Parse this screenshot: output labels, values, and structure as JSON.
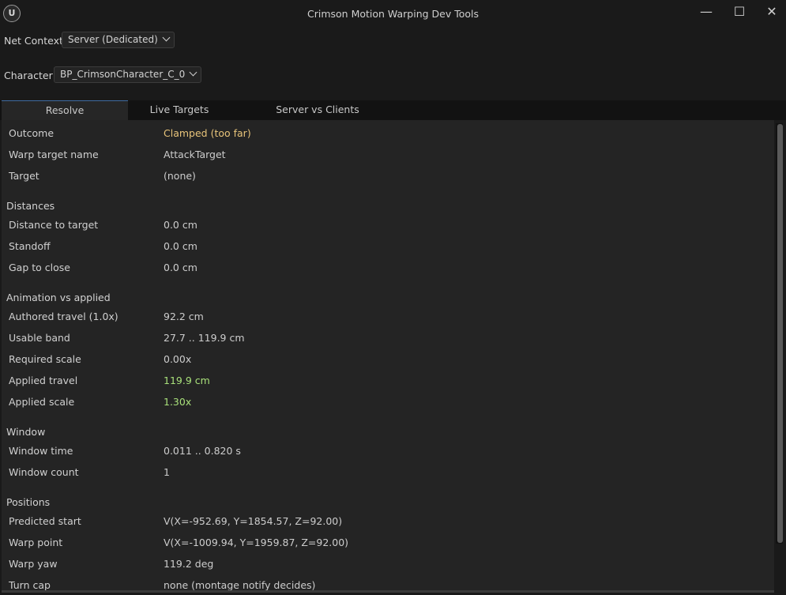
{
  "window": {
    "title": "Crimson Motion Warping Dev Tools",
    "logo_glyph": "U",
    "minimize_glyph": "—",
    "maximize_glyph": "☐",
    "close_glyph": "✕"
  },
  "net_context": {
    "label": "Net Context",
    "value": "Server (Dedicated)"
  },
  "character": {
    "label": "Character",
    "value": "BP_CrimsonCharacter_C_0"
  },
  "tabs": [
    {
      "label": "Resolve",
      "active": true
    },
    {
      "label": "Live Targets",
      "active": false
    },
    {
      "label": "Server vs Clients",
      "active": false
    }
  ],
  "resolve": {
    "outcome": {
      "label": "Outcome",
      "value": "Clamped (too far)"
    },
    "warp_target_name": {
      "label": "Warp target name",
      "value": "AttackTarget"
    },
    "target": {
      "label": "Target",
      "value": "(none)"
    },
    "distances": {
      "heading": "Distances",
      "distance_to_target": {
        "label": "Distance to target",
        "value": "0.0 cm"
      },
      "standoff": {
        "label": "Standoff",
        "value": "0.0 cm"
      },
      "gap_to_close": {
        "label": "Gap to close",
        "value": "0.0 cm"
      }
    },
    "animation": {
      "heading": "Animation vs applied",
      "authored_travel": {
        "label": "Authored travel (1.0x)",
        "value": "92.2 cm"
      },
      "usable_band": {
        "label": "Usable band",
        "value": "27.7 .. 119.9 cm"
      },
      "required_scale": {
        "label": "Required scale",
        "value": "0.00x"
      },
      "applied_travel": {
        "label": "Applied travel",
        "value": "119.9 cm"
      },
      "applied_scale": {
        "label": "Applied scale",
        "value": "1.30x"
      }
    },
    "window_section": {
      "heading": "Window",
      "window_time": {
        "label": "Window time",
        "value": "0.011 .. 0.820 s"
      },
      "window_count": {
        "label": "Window count",
        "value": "1"
      }
    },
    "positions": {
      "heading": "Positions",
      "predicted_start": {
        "label": "Predicted start",
        "value": "V(X=-952.69, Y=1854.57, Z=92.00)"
      },
      "warp_point": {
        "label": "Warp point",
        "value": "V(X=-1009.94, Y=1959.87, Z=92.00)"
      },
      "warp_yaw": {
        "label": "Warp yaw",
        "value": "119.2 deg"
      },
      "turn_cap": {
        "label": "Turn cap",
        "value": "none (montage notify decides)"
      }
    }
  },
  "colors": {
    "warning_value": "#e8c47a",
    "good_value": "#a8e07a",
    "tab_accent": "#3f6aa0"
  }
}
